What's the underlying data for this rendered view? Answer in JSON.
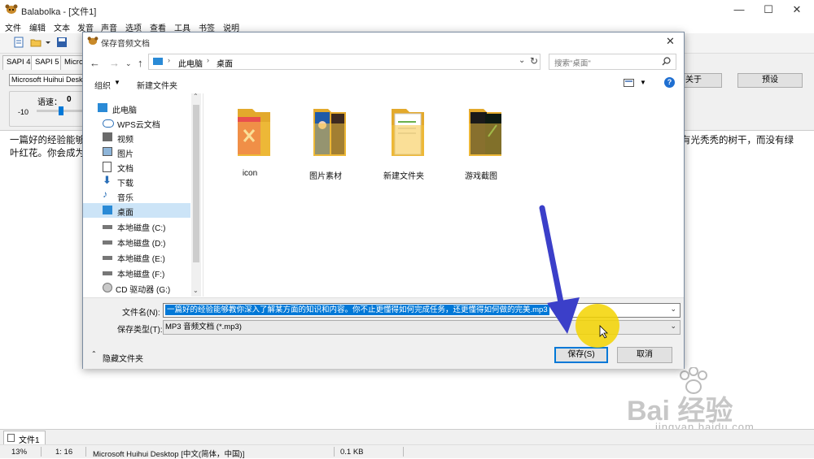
{
  "app": {
    "title": "Balabolka - [文件1]",
    "window_controls": [
      "—",
      "☐",
      "✕"
    ]
  },
  "menu": [
    "文件",
    "编辑",
    "文本",
    "发音",
    "声音",
    "选项",
    "查看",
    "工具",
    "书签",
    "说明"
  ],
  "tabs": [
    "SAPI 4",
    "SAPI 5",
    "Micros"
  ],
  "voice": {
    "selected": "Microsoft Huihui Deskto",
    "rate_label": "语速：",
    "rate_value": "0",
    "rate_min": "-10",
    "rate_fraction": 0.5
  },
  "right_buttons": [
    "关于",
    "预设"
  ],
  "editor": {
    "line1_left": "一篇好的经验能够",
    "line1_right": "有光秃秃的树干，而没有绿",
    "line2_left": "叶红花。你会成为"
  },
  "doc_tab": "文件1",
  "status": [
    "13%",
    "1:  16",
    "Microsoft Huihui Desktop [中文(简体，中国)]",
    "0.1 KB"
  ],
  "dialog": {
    "title": "保存音频文档",
    "breadcrumb": [
      "此电脑",
      "桌面"
    ],
    "search_placeholder": "搜索\"桌面\"",
    "organize": "组织",
    "new_folder": "新建文件夹",
    "nav_items": [
      {
        "label": "此电脑",
        "icon": "computer-icon"
      },
      {
        "label": "WPS云文档",
        "icon": "cloud-icon"
      },
      {
        "label": "视频",
        "icon": "video-icon"
      },
      {
        "label": "图片",
        "icon": "pictures-icon"
      },
      {
        "label": "文档",
        "icon": "documents-icon"
      },
      {
        "label": "下载",
        "icon": "download-icon"
      },
      {
        "label": "音乐",
        "icon": "music-icon"
      },
      {
        "label": "桌面",
        "icon": "desktop-icon"
      },
      {
        "label": "本地磁盘 (C:)",
        "icon": "drive-icon"
      },
      {
        "label": "本地磁盘 (D:)",
        "icon": "drive-icon"
      },
      {
        "label": "本地磁盘 (E:)",
        "icon": "drive-icon"
      },
      {
        "label": "本地磁盘 (F:)",
        "icon": "drive-icon"
      },
      {
        "label": "CD 驱动器 (G:)",
        "icon": "cd-icon"
      }
    ],
    "selected_nav": "桌面",
    "folders": [
      "icon",
      "图片素材",
      "新建文件夹",
      "游戏截图"
    ],
    "filename_label": "文件名(N):",
    "filename_value": "一篇好的经验能够教你深入了解某方面的知识和内容。你不止更懂得如何完成任务，还更懂得如何做的完美.mp3",
    "filetype_label": "保存类型(T):",
    "filetype_value": "MP3 音频文档 (*.mp3)",
    "hide_folders": "隐藏文件夹",
    "save_button": "保存(S)",
    "cancel_button": "取消"
  },
  "watermark": {
    "main": "Bai 经验",
    "sub": "jingyan.baidu.com"
  },
  "colors": {
    "arrow": "#3b3fc9",
    "cursor_highlight": "#f3d400",
    "selection": "#0078d7",
    "folder": "#f5c542",
    "help": "#1f6fd1"
  }
}
